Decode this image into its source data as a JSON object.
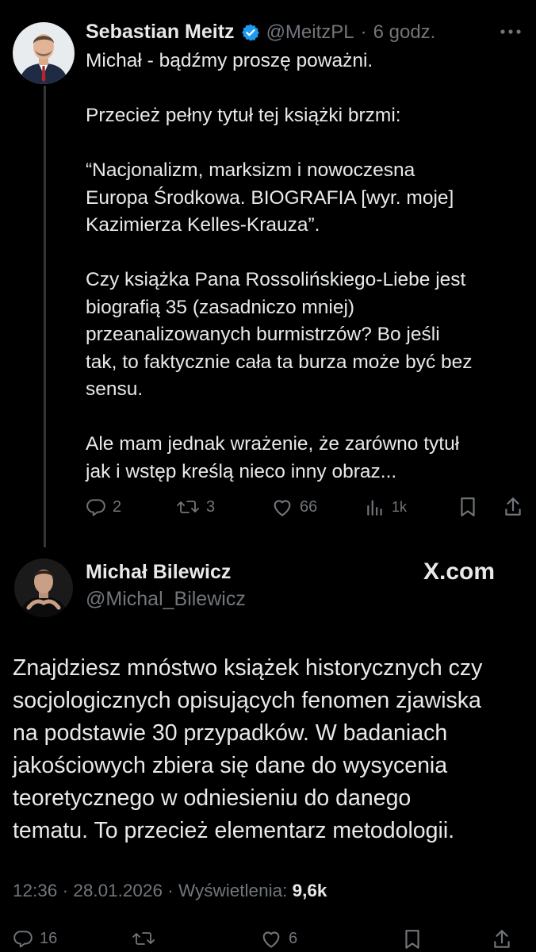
{
  "tweet1": {
    "author_name": "Sebastian Meitz",
    "handle": "@MeitzPL",
    "separator": "·",
    "time": "6 godz.",
    "more_icon": "ellipsis-icon",
    "verified_icon": "verified-badge-icon",
    "paragraphs": [
      "Michał - bądźmy proszę poważni.",
      "Przecież pełny tytuł tej książki brzmi:",
      "“Nacjonalizm, marksizm i nowoczesna\nEuropa Środkowa. BIOGRAFIA [wyr. moje]\nKazimierza Kelles-Krauza”.",
      "Czy książka Pana Rossolińskiego-Liebe jest\nbiografią 35 (zasadniczo mniej)\nprzeanalizowanych burmistrzów? Bo jeśli\ntak, to faktycznie cała ta burza może być bez\nsensu.",
      "Ale mam jednak wrażenie, że zarówno tytuł\njak i wstęp kreślą nieco inny obraz..."
    ],
    "actions": {
      "replies": "2",
      "reposts": "3",
      "likes": "66",
      "views": "1k"
    }
  },
  "tweet2": {
    "author_name": "Michał Bilewicz",
    "handle": "@Michal_Bilewicz",
    "brand": "X.com",
    "body": "Znajdziesz mnóstwo książek historycznych czy\nsocjologicznych opisujących fenomen zjawiska\nna podstawie 30 przypadków. W badaniach\njakościowych zbiera się dane do wysycenia\nteoretycznego w odniesieniu do danego\ntematu. To przecież elementarz metodologii.",
    "time": "12:36",
    "sep1": "·",
    "date": "28.01.2026",
    "sep2": "·",
    "views_label": "Wyświetlenia:",
    "views_value": "9,6k",
    "actions": {
      "replies": "16",
      "reposts": "",
      "likes": "6"
    }
  },
  "colors": {
    "background": "#000000",
    "text": "#e7e9ea",
    "secondary": "#71767b",
    "verified": "#1d9bf0",
    "thread_line": "#333639"
  }
}
